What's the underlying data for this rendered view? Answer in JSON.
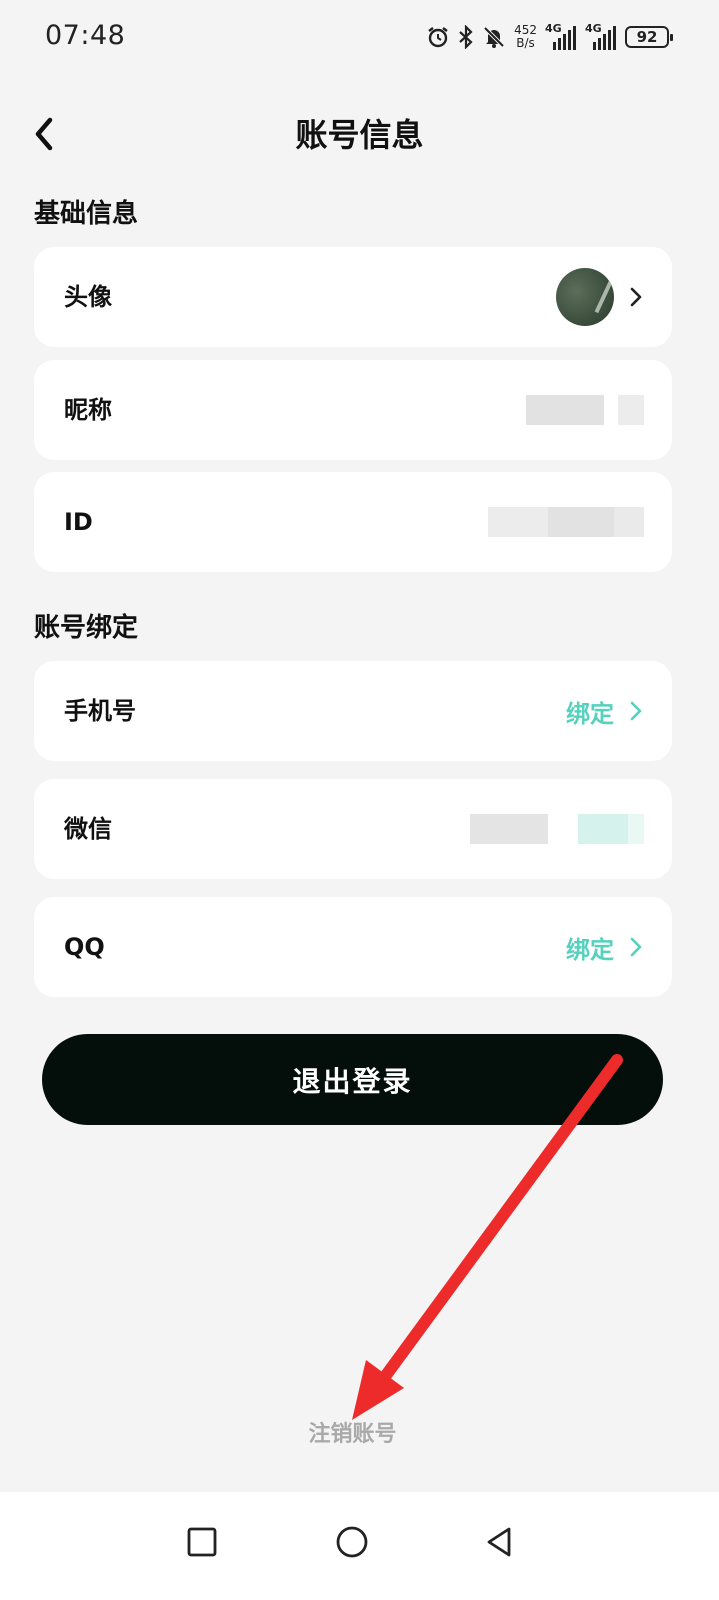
{
  "status_bar": {
    "time": "07:48",
    "net_speed_value": "452",
    "net_speed_unit": "B/s",
    "signal1_label": "4G",
    "signal2_label": "4G",
    "battery": "92",
    "icons": [
      "alarm-icon",
      "bluetooth-icon",
      "mute-bell-icon",
      "signal-icon",
      "battery-icon"
    ]
  },
  "header": {
    "title": "账号信息",
    "back_icon": "chevron-left-icon"
  },
  "basic_info": {
    "section_title": "基础信息",
    "items": [
      {
        "label": "头像",
        "kind": "avatar"
      },
      {
        "label": "昵称",
        "kind": "redacted"
      },
      {
        "label": "ID",
        "kind": "redacted"
      }
    ]
  },
  "account_binding": {
    "section_title": "账号绑定",
    "items": [
      {
        "label": "手机号",
        "action": "绑定"
      },
      {
        "label": "微信",
        "kind": "redacted"
      },
      {
        "label": "QQ",
        "action": "绑定"
      }
    ]
  },
  "logout_label": "退出登录",
  "cancel_account_label": "注销账号",
  "colors": {
    "accent": "#56d1bd",
    "button_bg": "#040f0c",
    "page_bg": "#f4f4f4",
    "annotation_arrow": "#ee2b2b"
  },
  "nav_bar": {
    "icons": [
      "recent-apps-icon",
      "home-icon",
      "back-triangle-icon"
    ]
  }
}
